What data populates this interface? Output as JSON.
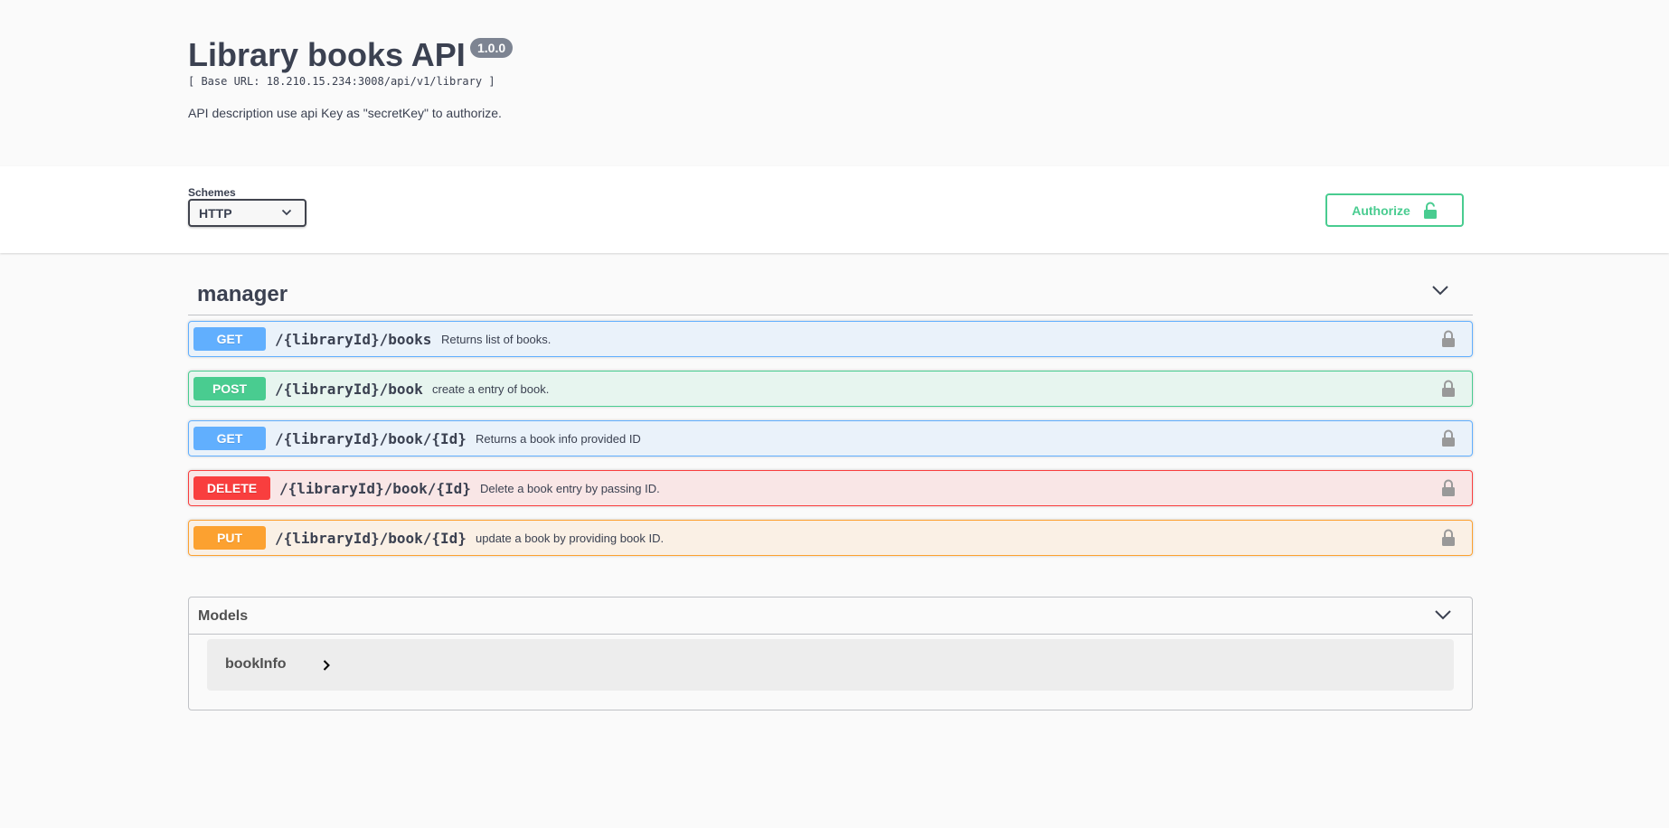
{
  "info": {
    "title": "Library books API",
    "version": "1.0.0",
    "base_url": "[ Base URL: 18.210.15.234:3008/api/v1/library ]",
    "description": "API description use api Key as \"secretKey\" to authorize."
  },
  "schemes": {
    "label": "Schemes",
    "selected": "HTTP"
  },
  "authorize": {
    "label": "Authorize"
  },
  "tag": {
    "name": "manager"
  },
  "operations": [
    {
      "method": "GET",
      "path": "/{libraryId}/books",
      "summary": "Returns list of books."
    },
    {
      "method": "POST",
      "path": "/{libraryId}/book",
      "summary": "create a entry of book."
    },
    {
      "method": "GET",
      "path": "/{libraryId}/book/{Id}",
      "summary": "Returns a book info provided ID"
    },
    {
      "method": "DELETE",
      "path": "/{libraryId}/book/{Id}",
      "summary": "Delete a book entry by passing ID."
    },
    {
      "method": "PUT",
      "path": "/{libraryId}/book/{Id}",
      "summary": "update a book by providing book ID."
    }
  ],
  "models": {
    "title": "Models",
    "items": [
      {
        "name": "bookInfo"
      }
    ]
  },
  "colors": {
    "get": "#61affe",
    "post": "#49cc90",
    "delete": "#f93e3e",
    "put": "#fca130"
  }
}
